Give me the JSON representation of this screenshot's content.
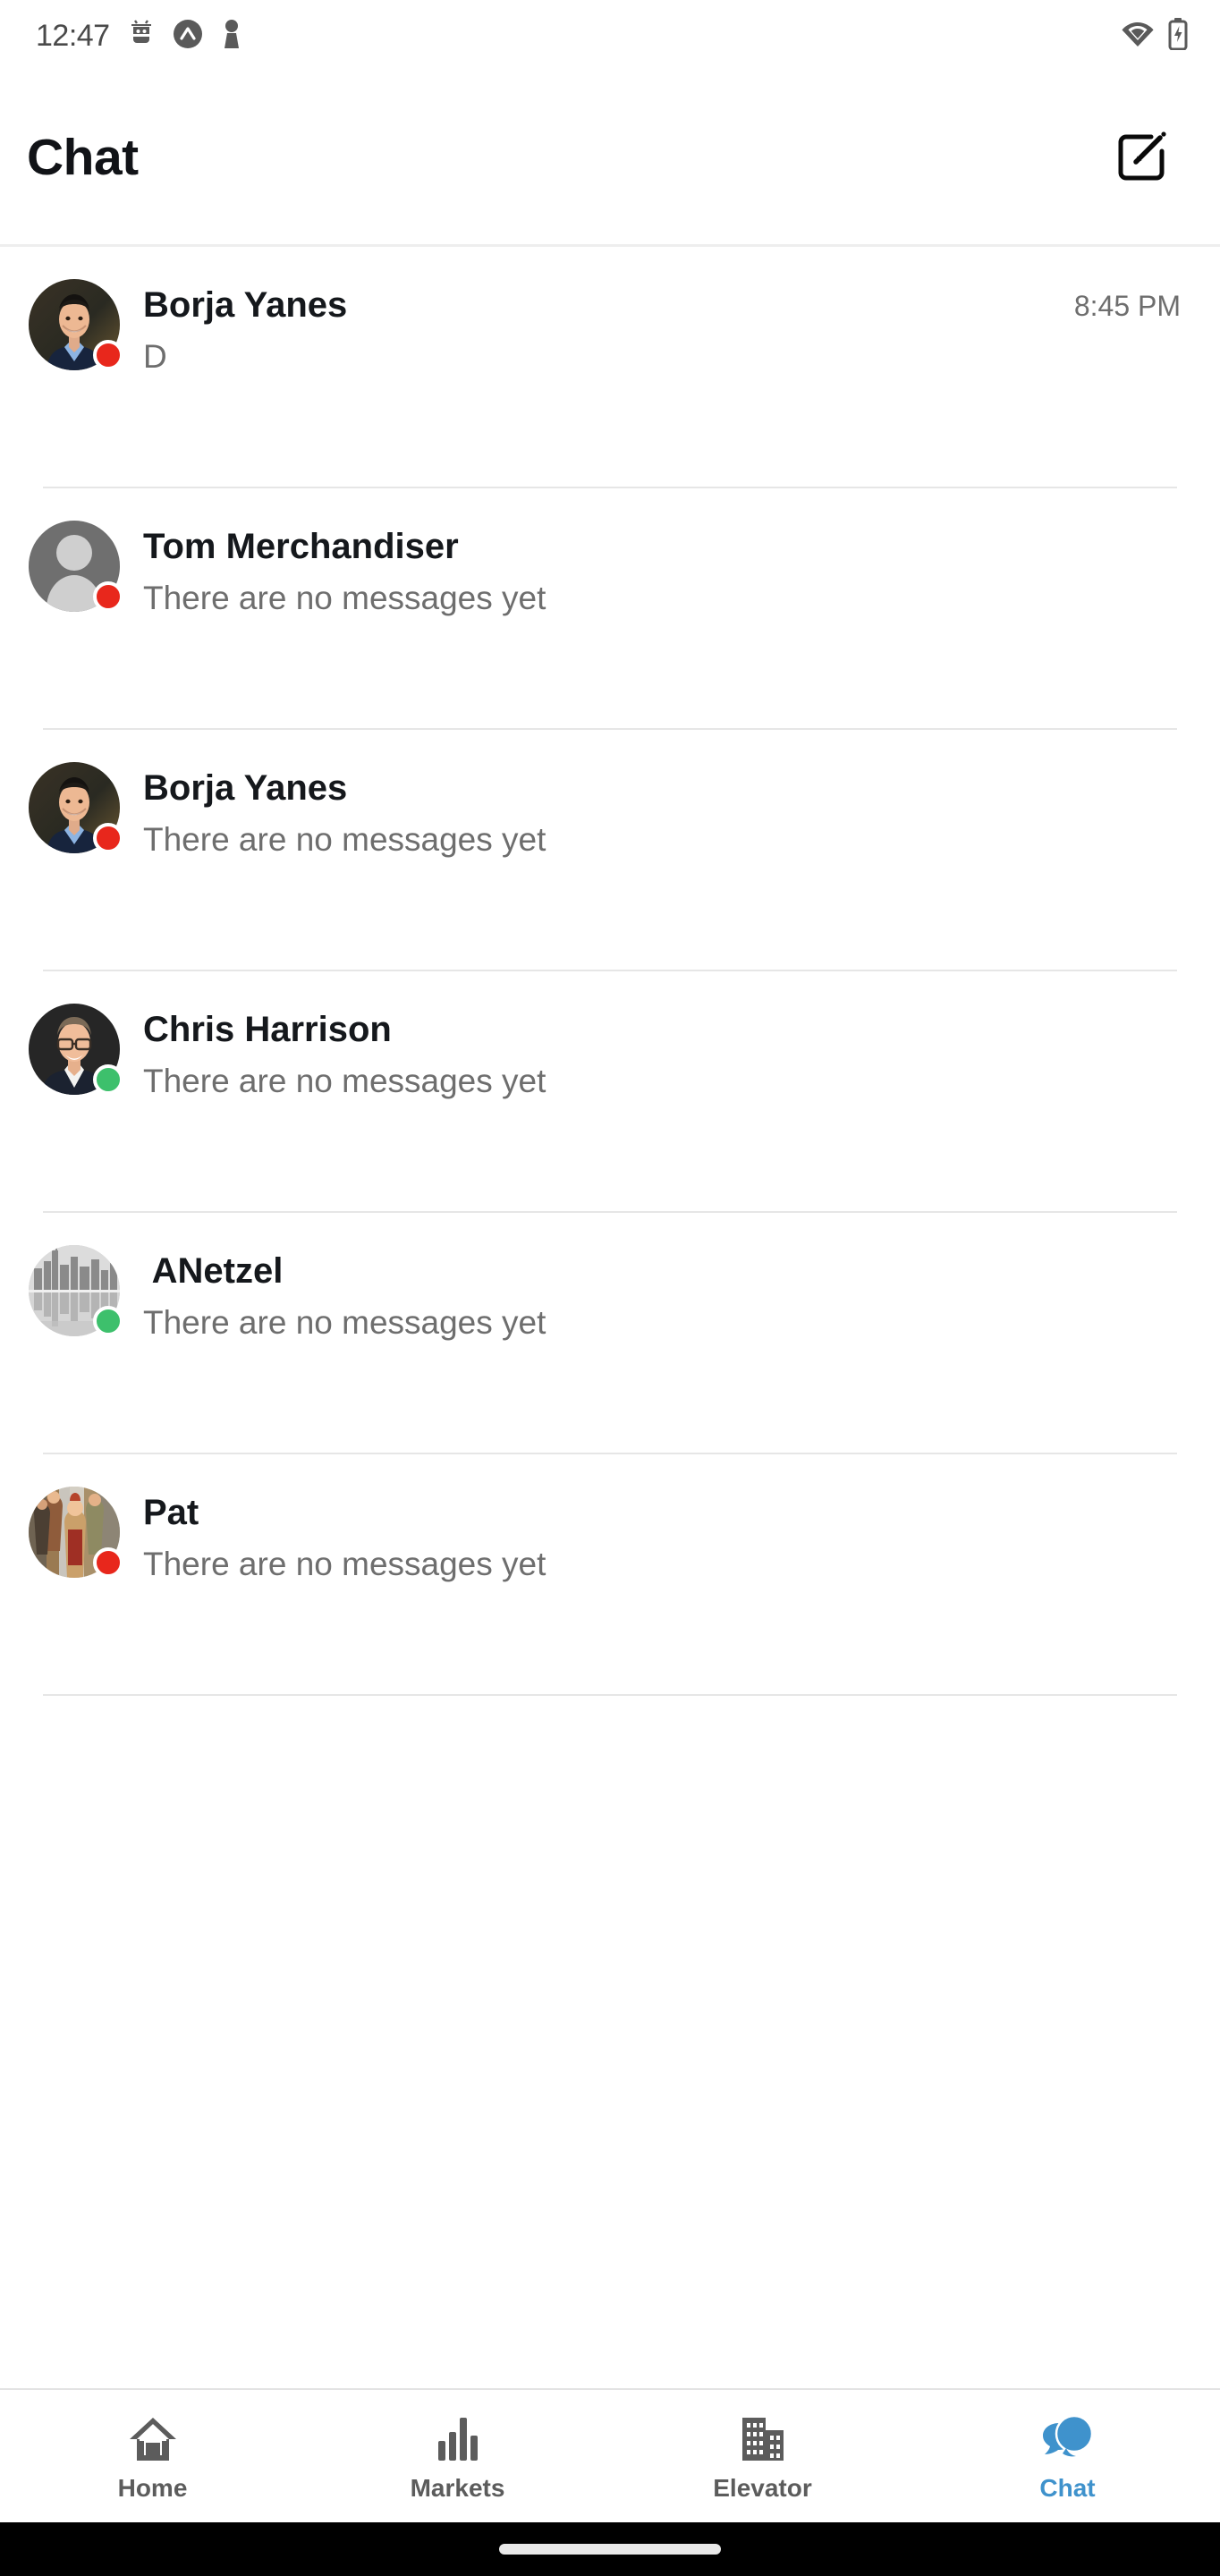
{
  "status_bar": {
    "time": "12:47",
    "left_icons": [
      "android-debug-icon",
      "circle-a-app-icon",
      "person-app-icon"
    ],
    "right_icons": [
      "wifi-icon",
      "battery-charging-icon"
    ]
  },
  "header": {
    "title": "Chat",
    "compose_icon": "compose-new-message-icon"
  },
  "chat_list": {
    "rows": [
      {
        "name": "Borja Yanes",
        "preview": "D",
        "time": "8:45 PM",
        "status": "offline",
        "avatar_type": "photo-man-blue-shirt"
      },
      {
        "name": "Tom Merchandiser",
        "preview": "There are no messages yet",
        "time": "",
        "status": "offline",
        "avatar_type": "placeholder-person"
      },
      {
        "name": "Borja Yanes",
        "preview": "There are no messages yet",
        "time": "",
        "status": "offline",
        "avatar_type": "photo-man-blue-shirt"
      },
      {
        "name": "Chris Harrison",
        "preview": "There are no messages yet",
        "time": "",
        "status": "online",
        "avatar_type": "photo-man-glasses"
      },
      {
        "name": " ANetzel",
        "preview": "There are no messages yet",
        "time": "",
        "status": "online",
        "avatar_type": "photo-city-skyline"
      },
      {
        "name": "Pat",
        "preview": "There are no messages yet",
        "time": "",
        "status": "offline",
        "avatar_type": "photo-group-people"
      }
    ]
  },
  "bottom_nav": {
    "items": [
      {
        "label": "Home",
        "icon": "home-icon",
        "active": false
      },
      {
        "label": "Markets",
        "icon": "bar-chart-icon",
        "active": false
      },
      {
        "label": "Elevator",
        "icon": "buildings-icon",
        "active": false
      },
      {
        "label": "Chat",
        "icon": "chat-bubbles-icon",
        "active": true
      }
    ]
  },
  "colors": {
    "accent": "#3f92cc",
    "online": "#3dc06c",
    "offline": "#e8271c",
    "title": "#111317",
    "secondary_text": "#6e6e6e",
    "divider": "#e6e6e6"
  }
}
